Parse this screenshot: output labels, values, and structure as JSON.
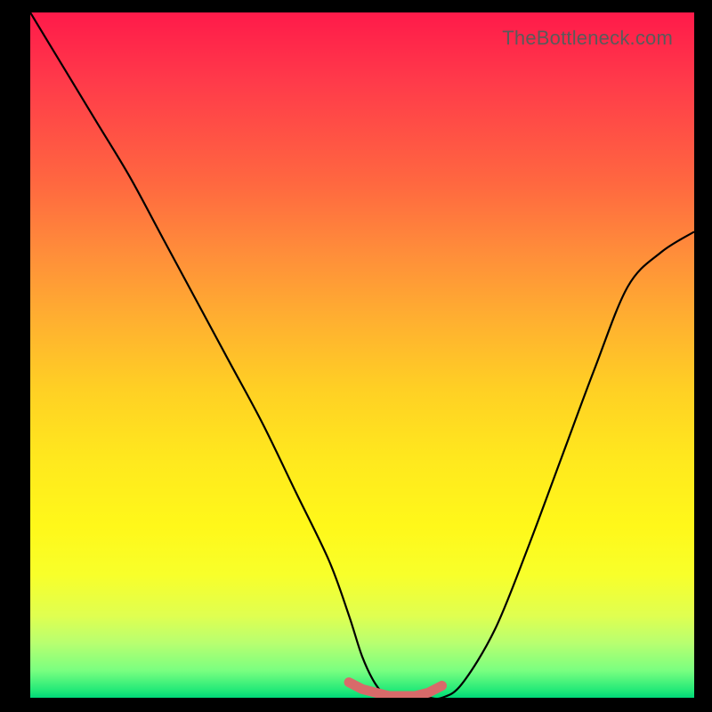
{
  "watermark": "TheBottleneck.com",
  "chart_data": {
    "type": "line",
    "title": "",
    "xlabel": "",
    "ylabel": "",
    "xlim": [
      0,
      100
    ],
    "ylim": [
      0,
      100
    ],
    "series": [
      {
        "name": "curve",
        "x": [
          0,
          5,
          10,
          15,
          20,
          25,
          30,
          35,
          40,
          45,
          48,
          50,
          52,
          54,
          56,
          58,
          60,
          62,
          65,
          70,
          75,
          80,
          85,
          90,
          95,
          100
        ],
        "values": [
          100,
          92,
          84,
          76,
          67,
          58,
          49,
          40,
          30,
          20,
          12,
          6,
          2,
          0,
          0,
          0,
          0,
          0,
          2,
          10,
          22,
          35,
          48,
          60,
          65,
          68
        ]
      },
      {
        "name": "flat-highlight",
        "x": [
          48,
          50,
          52,
          54,
          56,
          58,
          60,
          62
        ],
        "values": [
          2,
          1,
          0.5,
          0,
          0,
          0,
          0.5,
          1.5
        ]
      }
    ],
    "gradient": {
      "top": "#ff1a4a",
      "bottom": "#00d878"
    },
    "annotations": []
  }
}
